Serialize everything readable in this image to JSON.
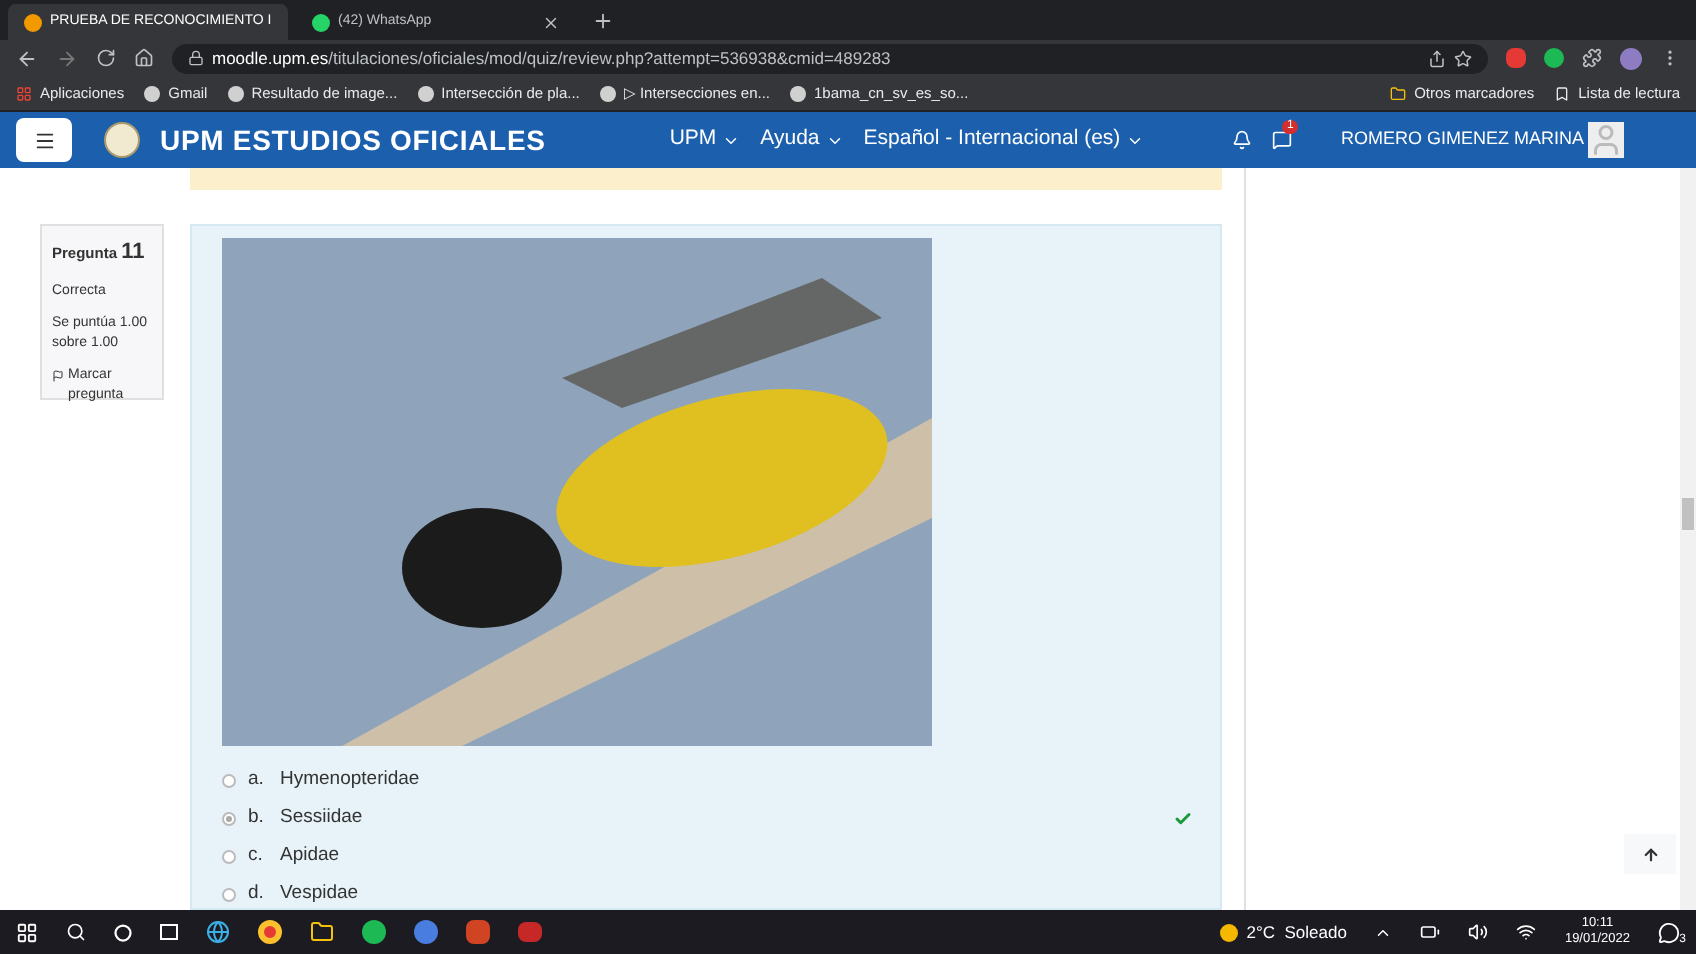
{
  "browser": {
    "tabs": [
      {
        "title": "PRUEBA DE RECONOCIMIENTO I",
        "selected": true
      },
      {
        "title": "(42) WhatsApp",
        "selected": false
      }
    ],
    "url_host": "moodle.upm.es",
    "url_path": "/titulaciones/oficiales/mod/quiz/review.php?attempt=536938&cmid=489283",
    "bookmarks": [
      "Aplicaciones",
      "Gmail",
      "Resultado de image...",
      "Intersección de pla...",
      "▷ Intersecciones en...",
      "1bama_cn_sv_es_so..."
    ],
    "bookmarks_right": [
      "Otros marcadores",
      "Lista de lectura"
    ]
  },
  "header": {
    "site_title": "UPM ESTUDIOS OFICIALES",
    "menus": [
      "UPM",
      "Ayuda",
      "Español - Internacional (es)"
    ],
    "message_badge": "1",
    "user_name": "ROMERO GIMENEZ MARINA"
  },
  "question_info": {
    "label": "Pregunta",
    "number": "11",
    "state": "Correcta",
    "grade": "Se puntúa 1.00 sobre 1.00",
    "flag": "Marcar pregunta"
  },
  "options": [
    {
      "letter": "a.",
      "text": "Hymenopteridae",
      "selected": false
    },
    {
      "letter": "b.",
      "text": "Sessiidae",
      "selected": true
    },
    {
      "letter": "c.",
      "text": "Apidae",
      "selected": false
    },
    {
      "letter": "d.",
      "text": "Vespidae",
      "selected": false
    }
  ],
  "taskbar": {
    "weather": "2°C  Soleado",
    "time": "10:11",
    "date": "19/01/2022",
    "notifications": "3"
  }
}
